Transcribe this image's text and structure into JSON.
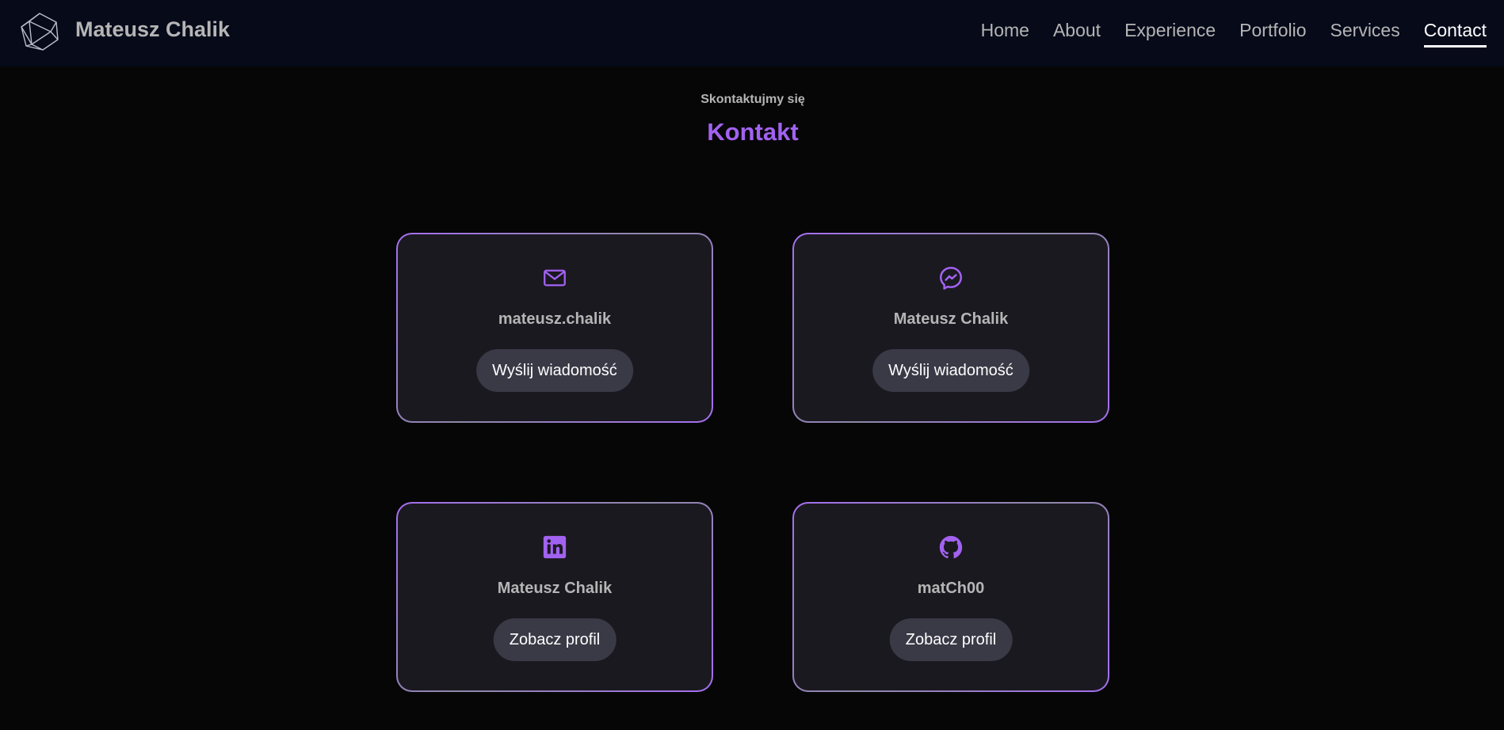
{
  "header": {
    "brand": "Mateusz Chalik",
    "logo_icon": "polyhedron-logo-icon",
    "nav": [
      {
        "label": "Home",
        "active": false
      },
      {
        "label": "About",
        "active": false
      },
      {
        "label": "Experience",
        "active": false
      },
      {
        "label": "Portfolio",
        "active": false
      },
      {
        "label": "Services",
        "active": false
      },
      {
        "label": "Contact",
        "active": true
      }
    ]
  },
  "section": {
    "subtitle": "Skontaktujmy się",
    "title": "Kontakt"
  },
  "cards": [
    {
      "icon": "mail-icon",
      "label": "mateusz.chalik",
      "button": "Wyślij wiadomość"
    },
    {
      "icon": "messenger-icon",
      "label": "Mateusz Chalik",
      "button": "Wyślij wiadomość"
    },
    {
      "icon": "linkedin-icon",
      "label": "Mateusz Chalik",
      "button": "Zobacz profil"
    },
    {
      "icon": "github-icon",
      "label": "matCh00",
      "button": "Zobacz profil"
    }
  ],
  "colors": {
    "accent": "#a262f0",
    "background": "#060606",
    "navbar": "#060a19",
    "card": "#1a1920",
    "button": "#3a3946",
    "text_muted": "#b5b5b5"
  }
}
